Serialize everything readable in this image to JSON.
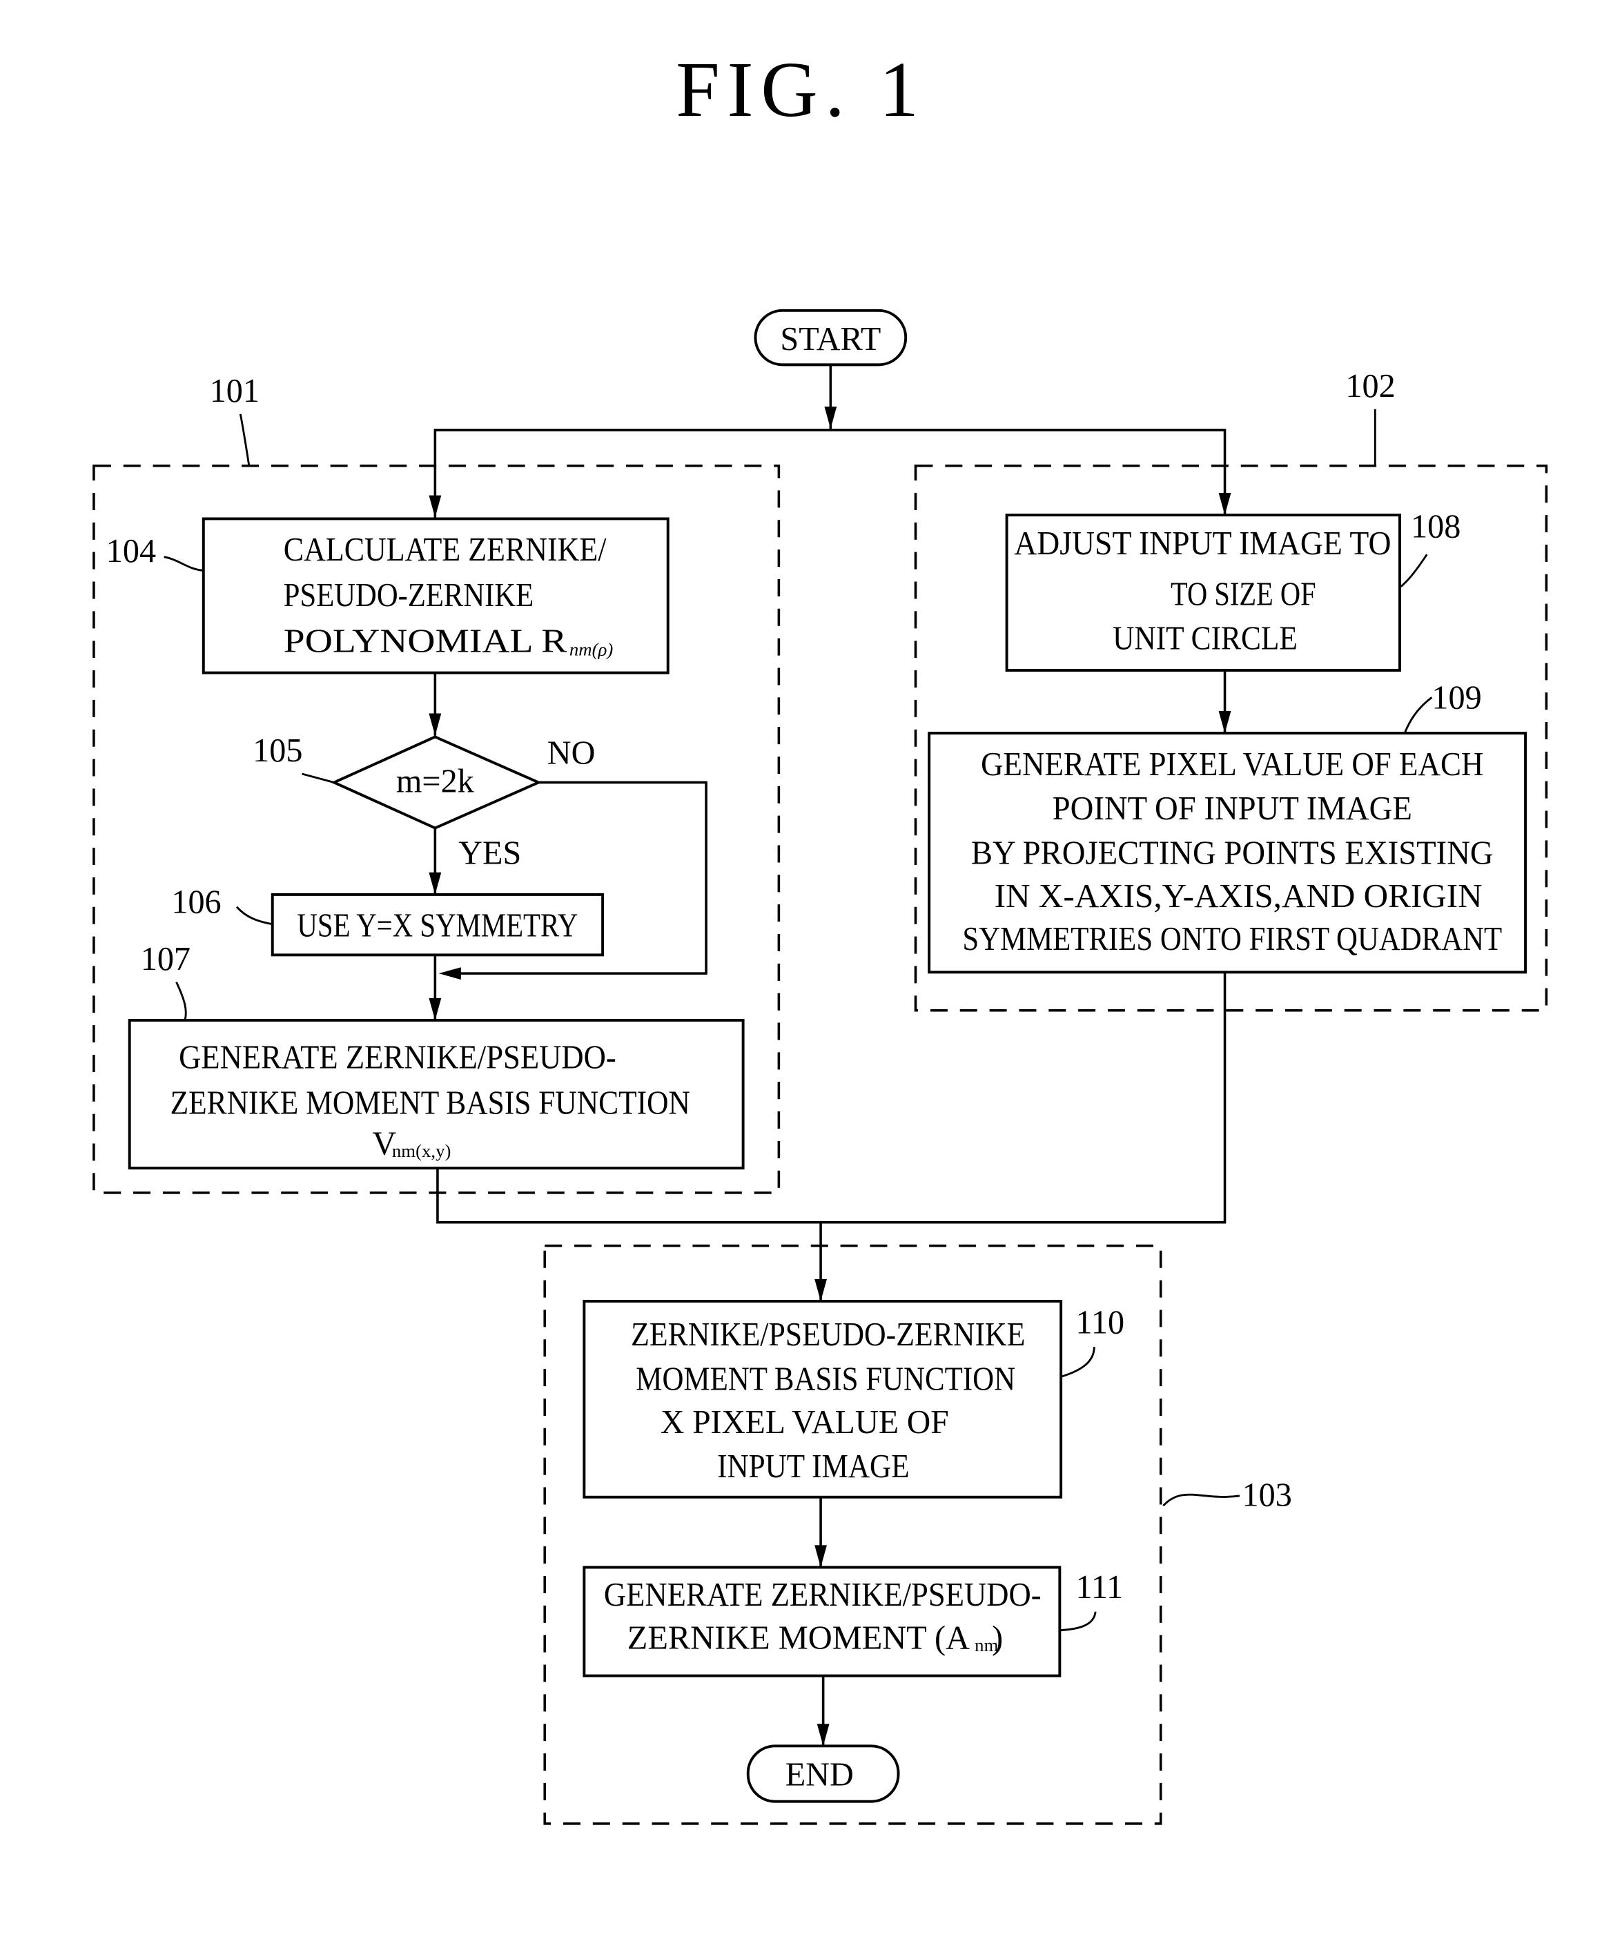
{
  "figure": {
    "title": "FIG. 1"
  },
  "terminals": {
    "start": "START",
    "end": "END"
  },
  "groups": {
    "g101": "101",
    "g102": "102",
    "g103": "103"
  },
  "steps": {
    "s104": {
      "ref": "104",
      "lines": [
        "CALCULATE ZERNIKE/",
        "PSEUDO-ZERNIKE",
        "POLYNOMIAL R"
      ],
      "subscript": "nm(ρ)"
    },
    "s105": {
      "ref": "105",
      "condition": "m=2k",
      "yes": "YES",
      "no": "NO"
    },
    "s106": {
      "ref": "106",
      "lines": [
        "USE Y=X SYMMETRY"
      ]
    },
    "s107": {
      "ref": "107",
      "lines": [
        "GENERATE ZERNIKE/PSEUDO-",
        "ZERNIKE MOMENT BASIS FUNCTION",
        "V"
      ],
      "subscript": "nm(x,y)"
    },
    "s108": {
      "ref": "108",
      "lines": [
        "ADJUST INPUT IMAGE TO",
        "TO SIZE OF",
        "UNIT CIRCLE"
      ]
    },
    "s109": {
      "ref": "109",
      "lines": [
        "GENERATE PIXEL VALUE OF EACH",
        "POINT OF INPUT IMAGE",
        "BY PROJECTING POINTS EXISTING",
        "IN X-AXIS,Y-AXIS,AND ORIGIN",
        "SYMMETRIES ONTO FIRST QUADRANT"
      ]
    },
    "s110": {
      "ref": "110",
      "lines": [
        "ZERNIKE/PSEUDO-ZERNIKE",
        "MOMENT BASIS FUNCTION",
        "X PIXEL VALUE OF",
        "INPUT IMAGE"
      ]
    },
    "s111": {
      "ref": "111",
      "lines": [
        "GENERATE ZERNIKE/PSEUDO-",
        "ZERNIKE MOMENT (A"
      ],
      "subscript": "nm",
      "suffix": ")"
    }
  }
}
